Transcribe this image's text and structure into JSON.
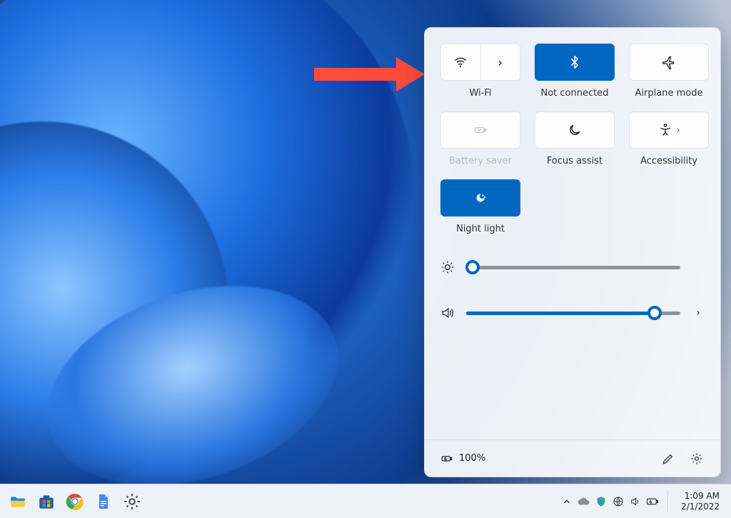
{
  "quick_settings": {
    "tiles": {
      "wifi": {
        "label": "Wi-Fi"
      },
      "bluetooth": {
        "label": "Not connected"
      },
      "airplane": {
        "label": "Airplane mode"
      },
      "battery": {
        "label": "Battery saver"
      },
      "focus": {
        "label": "Focus assist"
      },
      "access": {
        "label": "Accessibility"
      },
      "night": {
        "label": "Night light"
      }
    },
    "sliders": {
      "brightness": {
        "value_pct": 3
      },
      "volume": {
        "value_pct": 88
      }
    },
    "footer": {
      "battery_text": "100%"
    }
  },
  "taskbar": {
    "clock": {
      "time": "1:09 AM",
      "date": "2/1/2022"
    }
  },
  "colors": {
    "accent": "#0067c0"
  }
}
